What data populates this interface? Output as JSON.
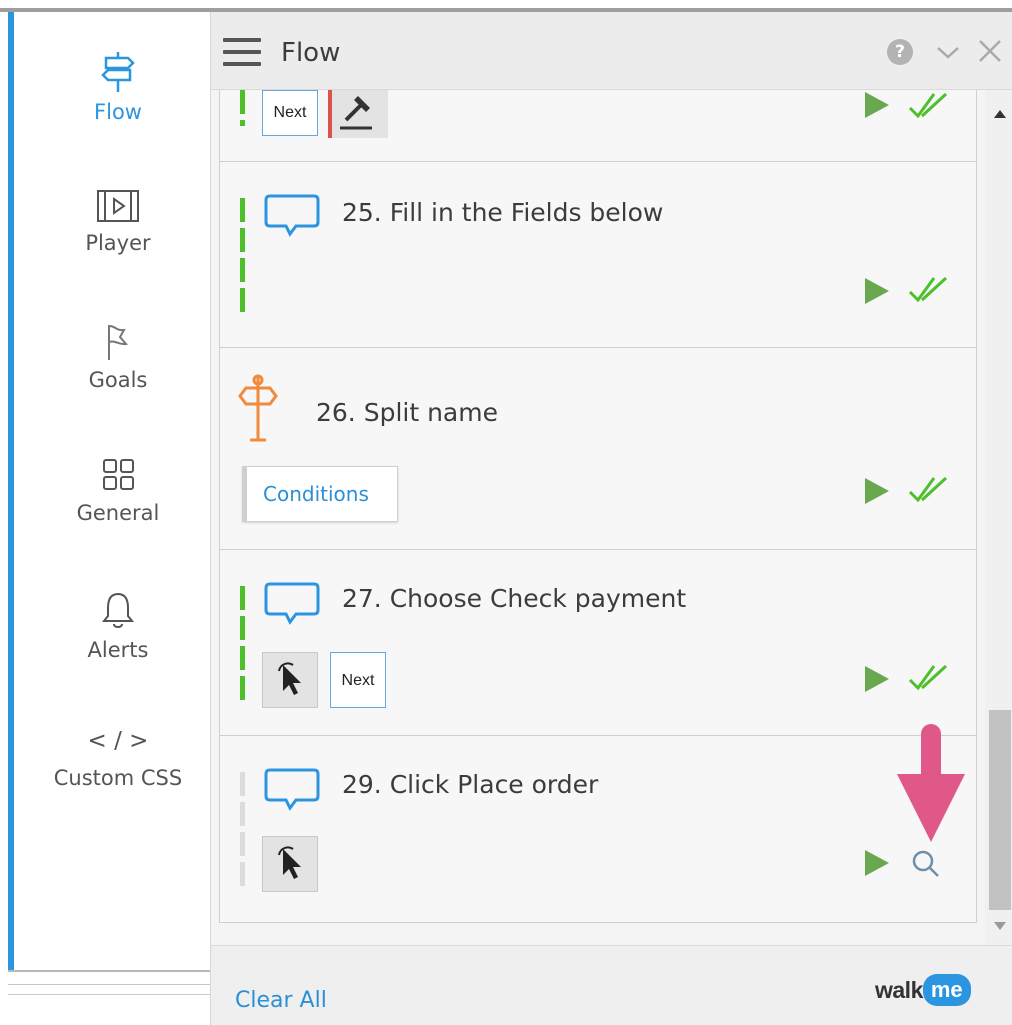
{
  "sidebar": {
    "items": [
      {
        "label": "Flow",
        "icon": "signpost-icon",
        "active": true
      },
      {
        "label": "Player",
        "icon": "film-play-icon",
        "active": false
      },
      {
        "label": "Goals",
        "icon": "flag-icon",
        "active": false
      },
      {
        "label": "General",
        "icon": "grid-icon",
        "active": false
      },
      {
        "label": "Alerts",
        "icon": "bell-icon",
        "active": false
      },
      {
        "label": "Custom CSS",
        "icon_text": "< / >",
        "active": false
      }
    ]
  },
  "header": {
    "title": "Flow",
    "help_label": "?"
  },
  "steps": [
    {
      "title": "",
      "buttons": [
        "Next"
      ],
      "status": "completed"
    },
    {
      "title": "25. Fill in the Fields below",
      "buttons": [],
      "status": "completed"
    },
    {
      "title": "26. Split name",
      "buttons": [
        "Conditions"
      ],
      "status": "completed"
    },
    {
      "title": "27. Choose Check payment",
      "buttons": [
        "Next"
      ],
      "status": "completed"
    },
    {
      "title": "29. Click Place order",
      "buttons": [],
      "status": "searching"
    }
  ],
  "footer": {
    "clear_all": "Clear All",
    "logo_text": "walk",
    "logo_badge": "me"
  },
  "colors": {
    "accent": "#2b95e0",
    "green": "#4cbf2b",
    "play": "#6aa84f",
    "annotation_arrow": "#e0588a",
    "split_icon": "#f08a3c"
  }
}
